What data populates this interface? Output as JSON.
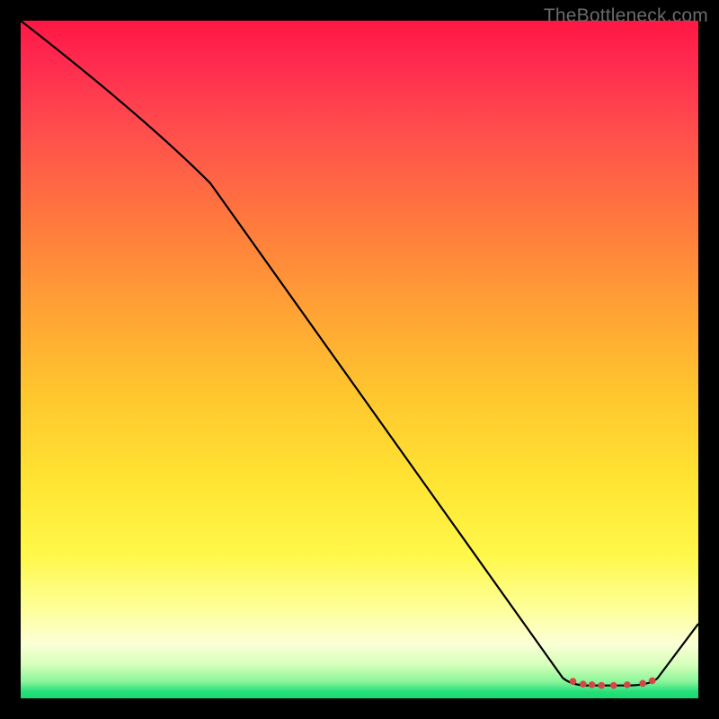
{
  "watermark": "TheBottleneck.com",
  "chart_data": {
    "type": "line",
    "title": "",
    "xlabel": "",
    "ylabel": "",
    "xlim": [
      0,
      100
    ],
    "ylim": [
      0,
      100
    ],
    "grid": false,
    "series": [
      {
        "name": "curve",
        "points": [
          {
            "x": 0,
            "y": 100
          },
          {
            "x": 28,
            "y": 76
          },
          {
            "x": 80,
            "y": 3
          },
          {
            "x": 82,
            "y": 2
          },
          {
            "x": 92,
            "y": 2
          },
          {
            "x": 94,
            "y": 3
          },
          {
            "x": 100,
            "y": 11
          }
        ]
      }
    ],
    "markers": [
      {
        "x": 81.5,
        "y": 2.5
      },
      {
        "x": 83.0,
        "y": 2.1
      },
      {
        "x": 84.3,
        "y": 2.0
      },
      {
        "x": 85.7,
        "y": 1.9
      },
      {
        "x": 87.5,
        "y": 1.9
      },
      {
        "x": 89.5,
        "y": 2.0
      },
      {
        "x": 91.8,
        "y": 2.2
      },
      {
        "x": 93.2,
        "y": 2.6
      }
    ],
    "background_gradient": {
      "stops": [
        {
          "pos": 0.0,
          "color": "#ff1744"
        },
        {
          "pos": 0.3,
          "color": "#ff7a3d"
        },
        {
          "pos": 0.55,
          "color": "#ffc62e"
        },
        {
          "pos": 0.8,
          "color": "#fff84a"
        },
        {
          "pos": 0.93,
          "color": "#fbffd6"
        },
        {
          "pos": 1.0,
          "color": "#1ad96f"
        }
      ]
    }
  }
}
